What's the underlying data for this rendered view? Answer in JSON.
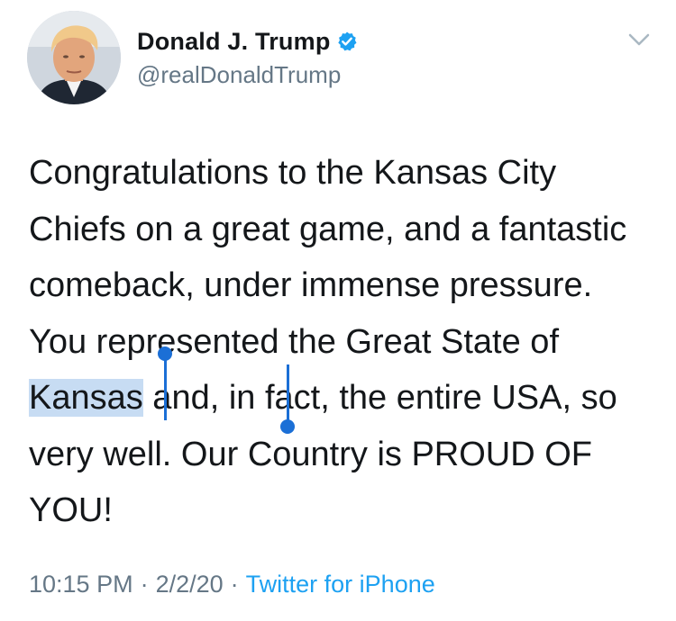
{
  "tweet": {
    "author": {
      "display_name": "Donald J. Trump",
      "handle": "@realDonaldTrump",
      "verified": true,
      "verified_icon": "verified-badge-icon",
      "verified_color": "#1da1f2"
    },
    "menu_icon": "chevron-down-icon",
    "text": {
      "before_selection": "Congratulations to the Kansas City Chiefs on a great game, and a fantastic comeback, under immense pressure. You represented the Great State of ",
      "selected": "Kansas",
      "after_selection": " and, in fact, the entire USA, so very well. Our Country is PROUD OF YOU!"
    },
    "selection_color": "#c7dcf3",
    "selection_handle_color": "#1b6fd6",
    "meta": {
      "time": "10:15 PM",
      "separator": "·",
      "date": "2/2/20",
      "source": "Twitter for iPhone",
      "source_color": "#1da1f2"
    }
  }
}
